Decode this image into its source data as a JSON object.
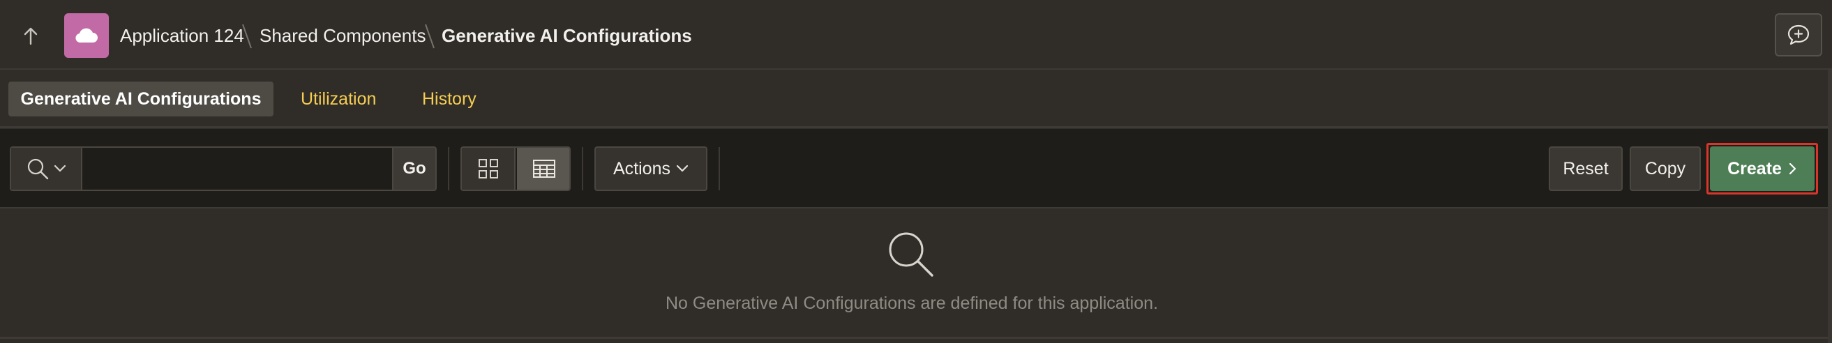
{
  "header": {
    "up_icon": "arrow-up-icon",
    "app_icon": "cloud-icon",
    "app_icon_color": "#c26aa6",
    "breadcrumb": [
      "Application 124",
      "Shared Components",
      "Generative AI Configurations"
    ],
    "feedback_icon": "chat-plus-icon"
  },
  "tabs": [
    {
      "label": "Generative AI Configurations",
      "active": true
    },
    {
      "label": "Utilization",
      "active": false
    },
    {
      "label": "History",
      "active": false
    }
  ],
  "toolbar": {
    "search_icon": "search-icon",
    "search_value": "",
    "search_placeholder": "",
    "go_label": "Go",
    "view_icons": [
      "grid-view-icon",
      "report-view-icon"
    ],
    "selected_view": "report",
    "actions_label": "Actions",
    "reset_label": "Reset",
    "copy_label": "Copy",
    "create_label": "Create",
    "create_color": "#4e7e56",
    "highlight_color": "#d9352a"
  },
  "empty_state": {
    "icon": "magnifier-icon",
    "message": "No Generative AI Configurations are defined for this application."
  },
  "colors": {
    "background": "#302d29",
    "toolbar_background": "#1f1d1a",
    "link_color": "#f5cd52"
  }
}
